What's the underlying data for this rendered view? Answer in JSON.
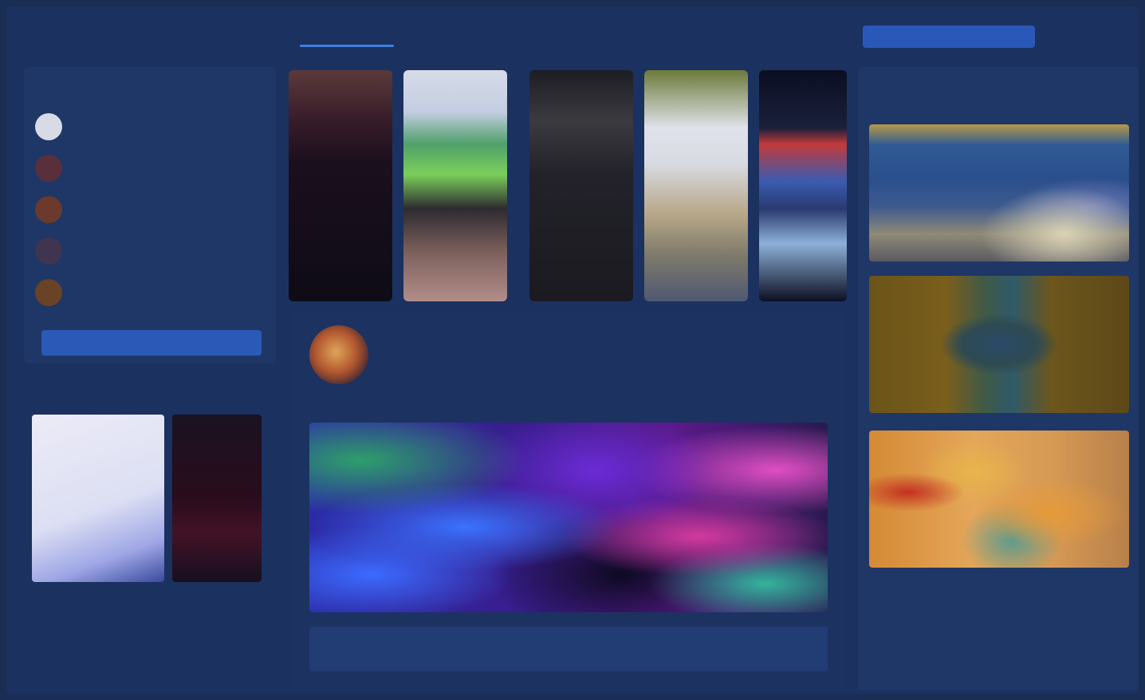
{
  "nav": {
    "brand": "",
    "links": [
      "",
      "",
      "",
      "",
      ""
    ],
    "search_placeholder": "",
    "close": ""
  },
  "left": {
    "title": "",
    "rows": [
      {
        "name": "",
        "count": ""
      },
      {
        "name": "",
        "count": ""
      },
      {
        "name": "",
        "count": ""
      },
      {
        "name": "",
        "count": ""
      },
      {
        "name": "",
        "count": ""
      }
    ],
    "button_label": "",
    "lower_title": "",
    "caption": ""
  },
  "stories": [
    "",
    "",
    "",
    "",
    ""
  ],
  "post": {
    "author": "",
    "time": "",
    "text": "",
    "actions": [
      "",
      "",
      ""
    ]
  },
  "right": {
    "title": "",
    "cards": [
      "",
      "",
      ""
    ]
  },
  "colors": {
    "background": "#1a2d55",
    "panel": "#1e3766",
    "accent": "#2b59b8",
    "active_link": "#5aa0ff"
  },
  "icons": [
    "close-icon"
  ]
}
